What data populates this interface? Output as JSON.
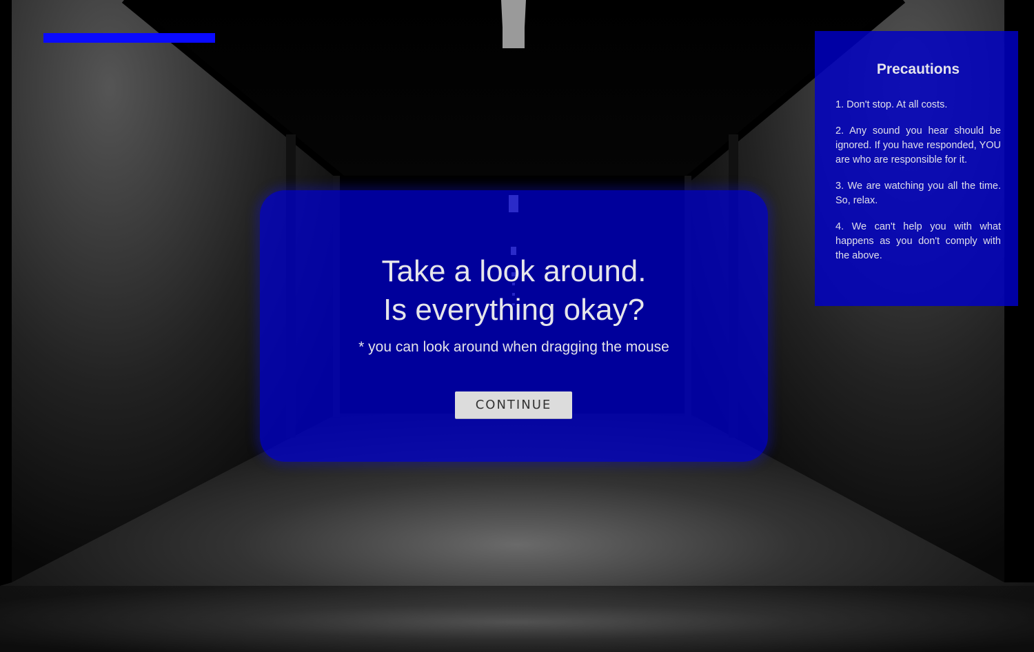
{
  "hud": {
    "health_level": 1.0,
    "health_color": "#0a0aff"
  },
  "dialog": {
    "title": "Take a look around.\nIs everything okay?",
    "hint": "* you can look around when dragging the mouse",
    "continue_label": "CONTINUE",
    "panel_color": "#0000d7"
  },
  "precautions": {
    "title": "Precautions",
    "items": [
      "1. Don't stop. At all costs.",
      "2. Any sound you hear should be ignored. If you have responded, YOU are who are responsible for it.",
      "3. We are watching you all the time. So, relax.",
      "4. We can't help you with what happens as you don't comply with the above."
    ]
  }
}
